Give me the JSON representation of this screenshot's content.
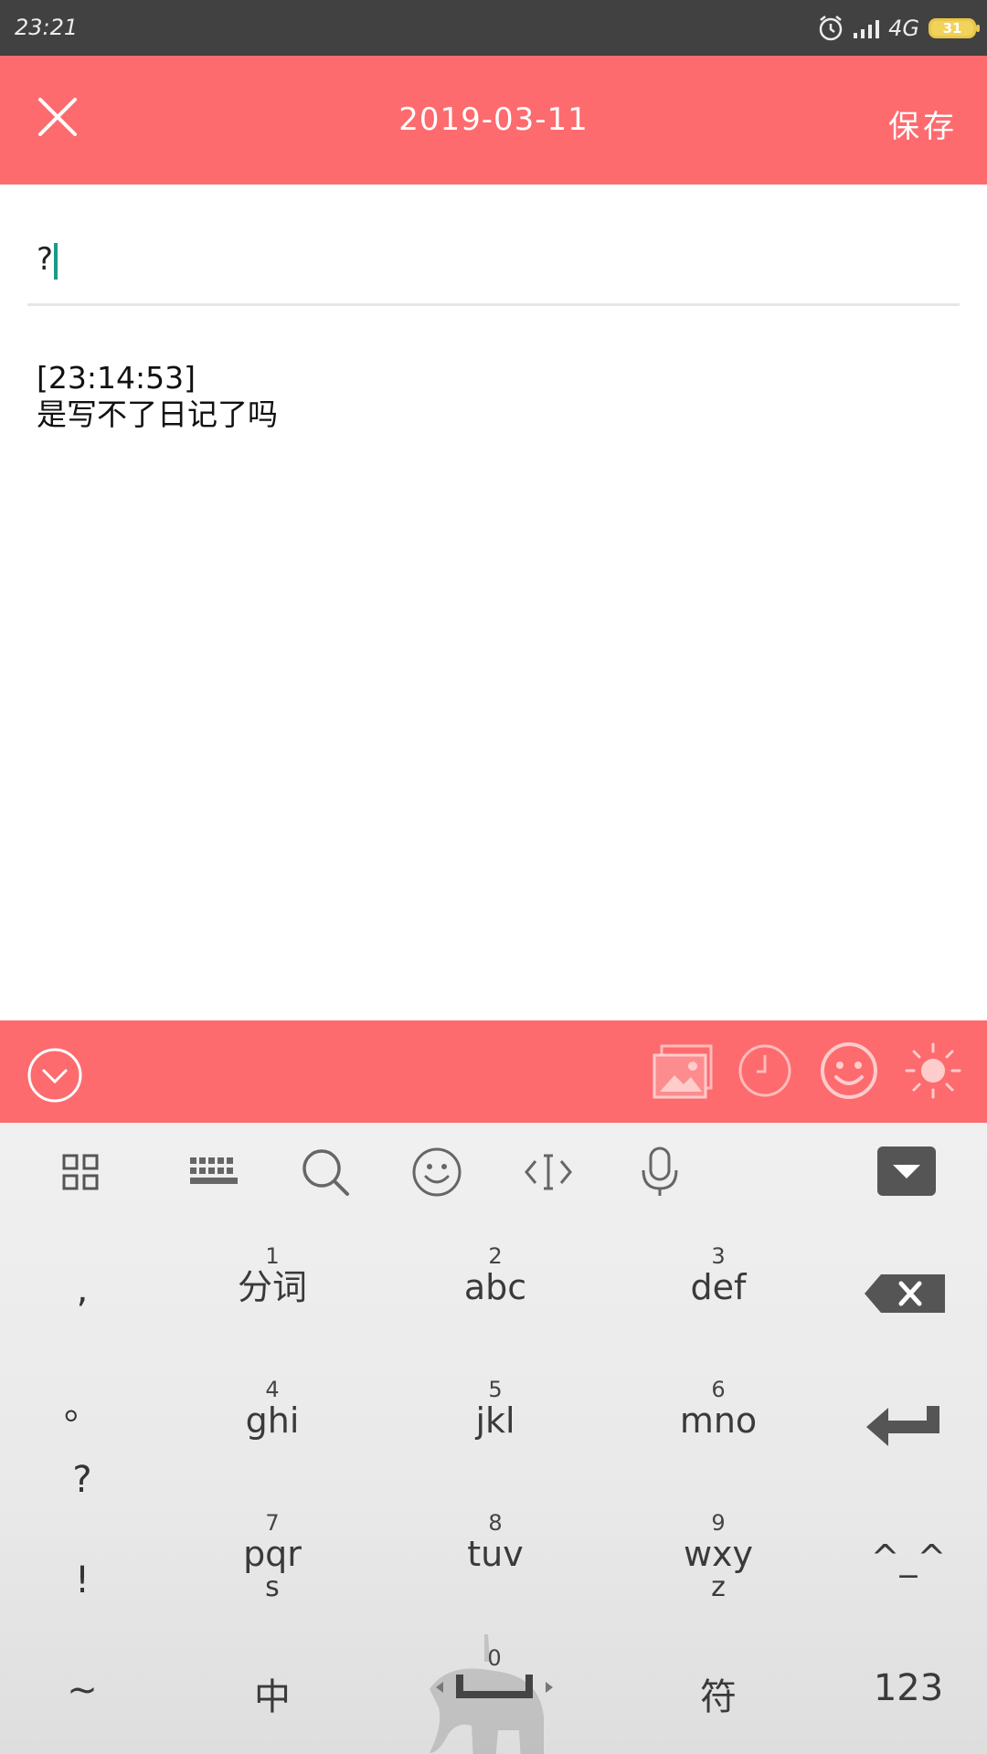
{
  "status_bar": {
    "time": "23:21",
    "network": "4G",
    "battery": "31"
  },
  "header": {
    "date": "2019-03-11",
    "save_label": "保存"
  },
  "editor": {
    "title_value": "?",
    "content_timestamp": "[23:14:53]",
    "content_text": "是写不了日记了吗"
  },
  "keyboard": {
    "keys": [
      {
        "num": "1",
        "label": "分词"
      },
      {
        "num": "2",
        "label": "abc"
      },
      {
        "num": "3",
        "label": "def"
      },
      {
        "num": "4",
        "label": "ghi"
      },
      {
        "num": "5",
        "label": "jkl"
      },
      {
        "num": "6",
        "label": "mno"
      },
      {
        "num": "7",
        "label": "pqr",
        "label2": "s"
      },
      {
        "num": "8",
        "label": "tuv"
      },
      {
        "num": "9",
        "label": "wxy",
        "label2": "z"
      }
    ],
    "punctuation": [
      ",",
      "。",
      "?",
      "!"
    ],
    "bottom": {
      "tilde": "~",
      "zh": "中",
      "space_num": "0",
      "symbol": "符",
      "numeric": "123"
    },
    "emoticon": "^_^"
  },
  "colors": {
    "accent": "#fd6b6e",
    "status_bar": "#414141",
    "caret": "#1b9a89"
  }
}
